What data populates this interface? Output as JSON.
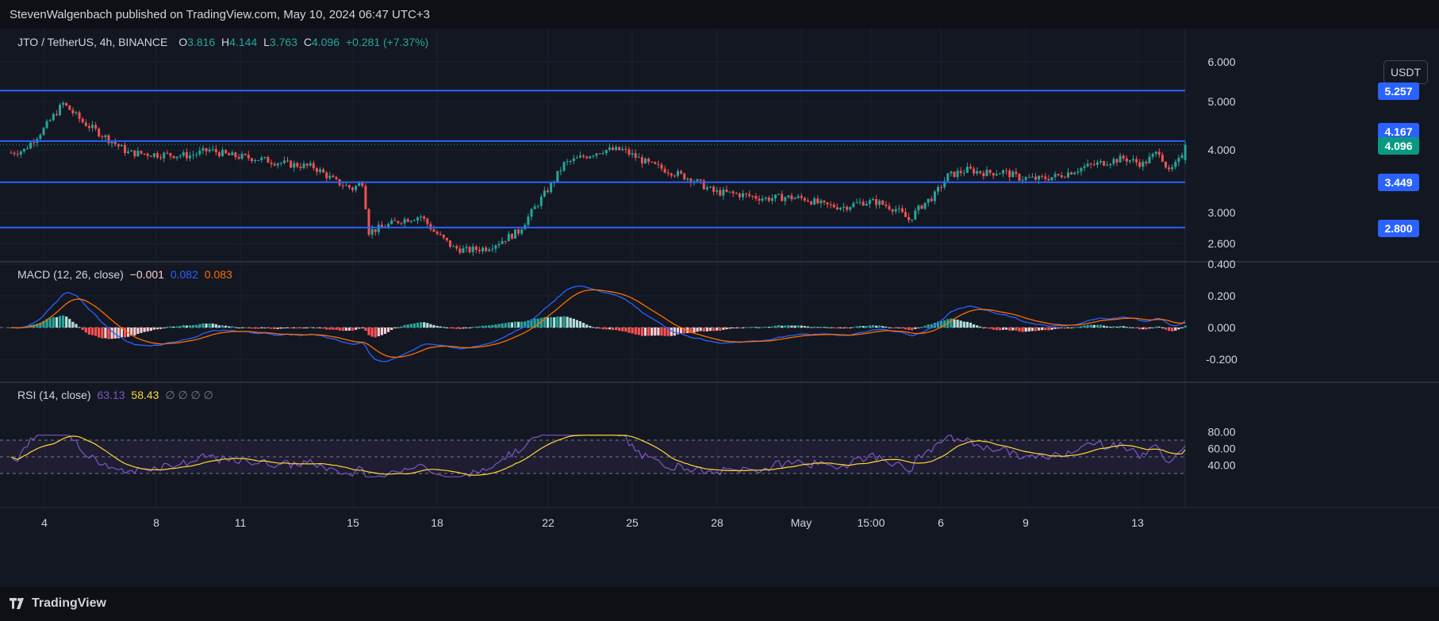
{
  "header": {
    "publisher": "StevenWalgenbach published on TradingView.com, May 10, 2024 06:47 UTC+3"
  },
  "legend": {
    "symbol": "JTO / TetherUS, 4h, BINANCE",
    "o_label": "O",
    "o_value": "3.816",
    "h_label": "H",
    "h_value": "4.144",
    "l_label": "L",
    "l_value": "3.763",
    "c_label": "C",
    "c_value": "4.096",
    "change": "+0.281 (+7.37%)"
  },
  "currency_button": "USDT",
  "macd_legend": {
    "label": "MACD (12, 26, close)",
    "hist": "−0.001",
    "macd": "0.082",
    "signal": "0.083"
  },
  "rsi_legend": {
    "label": "RSI (14, close)",
    "rsi": "63.13",
    "ma": "58.43",
    "extra": "∅ ∅ ∅ ∅"
  },
  "price_tags": {
    "line1": "5.257",
    "line2": "4.167",
    "current": "4.096",
    "line3": "3.449",
    "line4": "2.800"
  },
  "footer": {
    "brand": "TradingView"
  },
  "colors": {
    "background": "#131722",
    "up": "#26a69a",
    "down": "#ef5350",
    "hline": "#2962ff",
    "macd_line": "#2962ff",
    "signal_line": "#ff6d00",
    "rsi_line": "#7e57c2",
    "rsi_ma": "#fdd835",
    "hist_up_strong": "#26a69a",
    "hist_up_weak": "#b2dfdb",
    "hist_down_strong": "#ff5252",
    "hist_down_weak": "#ffcdd2"
  },
  "chart_data": [
    {
      "type": "candlestick",
      "title": "JTO / TetherUS, 4h, BINANCE",
      "x_tick_labels": [
        "4",
        "8",
        "11",
        "15",
        "18",
        "22",
        "25",
        "28",
        "May",
        "15:00",
        "6",
        "9",
        "13"
      ],
      "y_tick_labels": [
        "6.000",
        "5.000",
        "4.000",
        "3.000",
        "2.600"
      ],
      "y_scale": "log",
      "horizontal_lines": [
        5.257,
        4.167,
        3.449,
        2.8
      ],
      "last_close": 4.096,
      "close_path": [
        [
          0,
          3.95
        ],
        [
          4,
          4.0
        ],
        [
          10,
          4.4
        ],
        [
          16,
          4.95
        ],
        [
          22,
          4.55
        ],
        [
          30,
          4.2
        ],
        [
          36,
          3.95
        ],
        [
          45,
          3.92
        ],
        [
          55,
          3.9
        ],
        [
          61,
          4.0
        ],
        [
          67,
          3.9
        ],
        [
          75,
          3.85
        ],
        [
          85,
          3.75
        ],
        [
          93,
          3.7
        ],
        [
          100,
          3.45
        ],
        [
          105,
          3.35
        ],
        [
          108,
          3.45
        ],
        [
          110,
          2.75
        ],
        [
          114,
          2.8
        ],
        [
          120,
          2.9
        ],
        [
          126,
          2.95
        ],
        [
          130,
          2.75
        ],
        [
          136,
          2.55
        ],
        [
          140,
          2.52
        ],
        [
          146,
          2.55
        ],
        [
          150,
          2.62
        ],
        [
          156,
          2.75
        ],
        [
          160,
          3.0
        ],
        [
          166,
          3.4
        ],
        [
          170,
          3.75
        ],
        [
          176,
          3.88
        ],
        [
          182,
          4.0
        ],
        [
          188,
          4.0
        ],
        [
          196,
          3.75
        ],
        [
          204,
          3.6
        ],
        [
          210,
          3.48
        ],
        [
          216,
          3.3
        ],
        [
          224,
          3.26
        ],
        [
          232,
          3.2
        ],
        [
          238,
          3.22
        ],
        [
          244,
          3.2
        ],
        [
          250,
          3.1
        ],
        [
          256,
          3.08
        ],
        [
          262,
          3.15
        ],
        [
          266,
          3.15
        ],
        [
          272,
          3.05
        ],
        [
          276,
          2.9
        ],
        [
          280,
          3.1
        ],
        [
          284,
          3.25
        ],
        [
          288,
          3.55
        ],
        [
          294,
          3.65
        ],
        [
          300,
          3.6
        ],
        [
          305,
          3.62
        ],
        [
          310,
          3.52
        ],
        [
          316,
          3.5
        ],
        [
          322,
          3.55
        ],
        [
          330,
          3.7
        ],
        [
          336,
          3.78
        ],
        [
          342,
          3.85
        ],
        [
          348,
          3.75
        ],
        [
          353,
          3.98
        ],
        [
          356,
          3.6
        ],
        [
          359,
          3.8
        ],
        [
          361,
          4.096
        ]
      ]
    },
    {
      "type": "bar+line",
      "title": "MACD (12, 26, close)",
      "y_tick_labels": [
        "0.400",
        "0.200",
        "0.000",
        "-0.200"
      ],
      "last_values": {
        "histogram": -0.001,
        "macd": 0.082,
        "signal": 0.083
      }
    },
    {
      "type": "line",
      "title": "RSI (14, close)",
      "y_tick_labels": [
        "80.00",
        "60.00",
        "40.00"
      ],
      "band": [
        30,
        70
      ],
      "last_values": {
        "rsi": 63.13,
        "rsi_ma": 58.43
      }
    }
  ]
}
